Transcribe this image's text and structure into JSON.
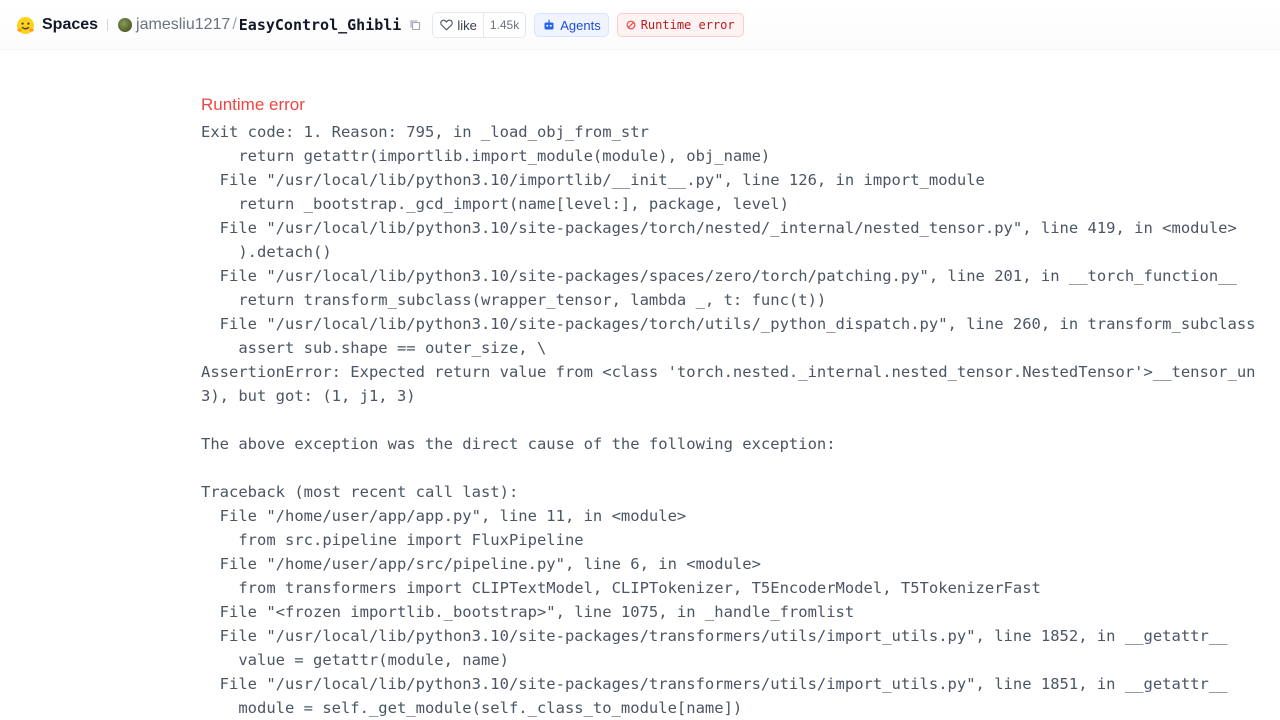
{
  "header": {
    "spaces_label": "Spaces",
    "owner": "jamesliu1217",
    "separator": "/",
    "repo": "EasyControl_Ghibli",
    "like_label": "like",
    "like_count": "1.45k",
    "agents_label": "Agents",
    "status_label": "Runtime error",
    "icons": {
      "logo": "hugging-face-logo-icon",
      "copy": "copy-icon",
      "like": "heart-icon",
      "agents": "robot-icon",
      "status": "error-circle-icon"
    },
    "colors": {
      "status": "#b91c1c",
      "agents": "#1d4ed8",
      "title_error": "#ef4444"
    }
  },
  "error": {
    "title": "Runtime error",
    "lines": [
      "Exit code: 1. Reason: 795, in _load_obj_from_str",
      "    return getattr(importlib.import_module(module), obj_name)",
      "  File \"/usr/local/lib/python3.10/importlib/__init__.py\", line 126, in import_module",
      "    return _bootstrap._gcd_import(name[level:], package, level)",
      "  File \"/usr/local/lib/python3.10/site-packages/torch/nested/_internal/nested_tensor.py\", line 419, in <module>",
      "    ).detach()",
      "  File \"/usr/local/lib/python3.10/site-packages/spaces/zero/torch/patching.py\", line 201, in __torch_function__",
      "    return transform_subclass(wrapper_tensor, lambda _, t: func(t))",
      "  File \"/usr/local/lib/python3.10/site-packages/torch/utils/_python_dispatch.py\", line 260, in transform_subclass",
      "    assert sub.shape == outer_size, \\",
      "AssertionError: Expected return value from <class 'torch.nested._internal.nested_tensor.NestedTensor'>__tensor_un",
      "3), but got: (1, j1, 3)",
      "",
      "The above exception was the direct cause of the following exception:",
      "",
      "Traceback (most recent call last):",
      "  File \"/home/user/app/app.py\", line 11, in <module>",
      "    from src.pipeline import FluxPipeline",
      "  File \"/home/user/app/src/pipeline.py\", line 6, in <module>",
      "    from transformers import CLIPTextModel, CLIPTokenizer, T5EncoderModel, T5TokenizerFast",
      "  File \"<frozen importlib._bootstrap>\", line 1075, in _handle_fromlist",
      "  File \"/usr/local/lib/python3.10/site-packages/transformers/utils/import_utils.py\", line 1852, in __getattr__",
      "    value = getattr(module, name)",
      "  File \"/usr/local/lib/python3.10/site-packages/transformers/utils/import_utils.py\", line 1851, in __getattr__",
      "    module = self._get_module(self._class_to_module[name])"
    ]
  }
}
